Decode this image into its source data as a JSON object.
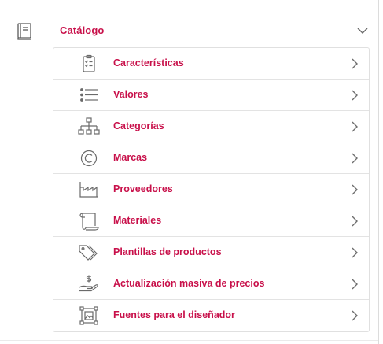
{
  "section": {
    "title": "Catálogo",
    "icon": "book-icon",
    "expanded": true
  },
  "items": [
    {
      "label": "Características",
      "icon": "clipboard-checklist-icon"
    },
    {
      "label": "Valores",
      "icon": "list-icon"
    },
    {
      "label": "Categorías",
      "icon": "hierarchy-icon"
    },
    {
      "label": "Marcas",
      "icon": "copyright-icon"
    },
    {
      "label": "Proveedores",
      "icon": "factory-icon"
    },
    {
      "label": "Materiales",
      "icon": "scroll-icon"
    },
    {
      "label": "Plantillas de productos",
      "icon": "tags-icon"
    },
    {
      "label": "Actualización masiva de precios",
      "icon": "hand-dollar-icon"
    },
    {
      "label": "Fuentes para el diseñador",
      "icon": "image-frame-icon"
    }
  ],
  "colors": {
    "accent": "#c8104a",
    "icon": "#6a6a6a",
    "border": "#e0e0e0"
  }
}
